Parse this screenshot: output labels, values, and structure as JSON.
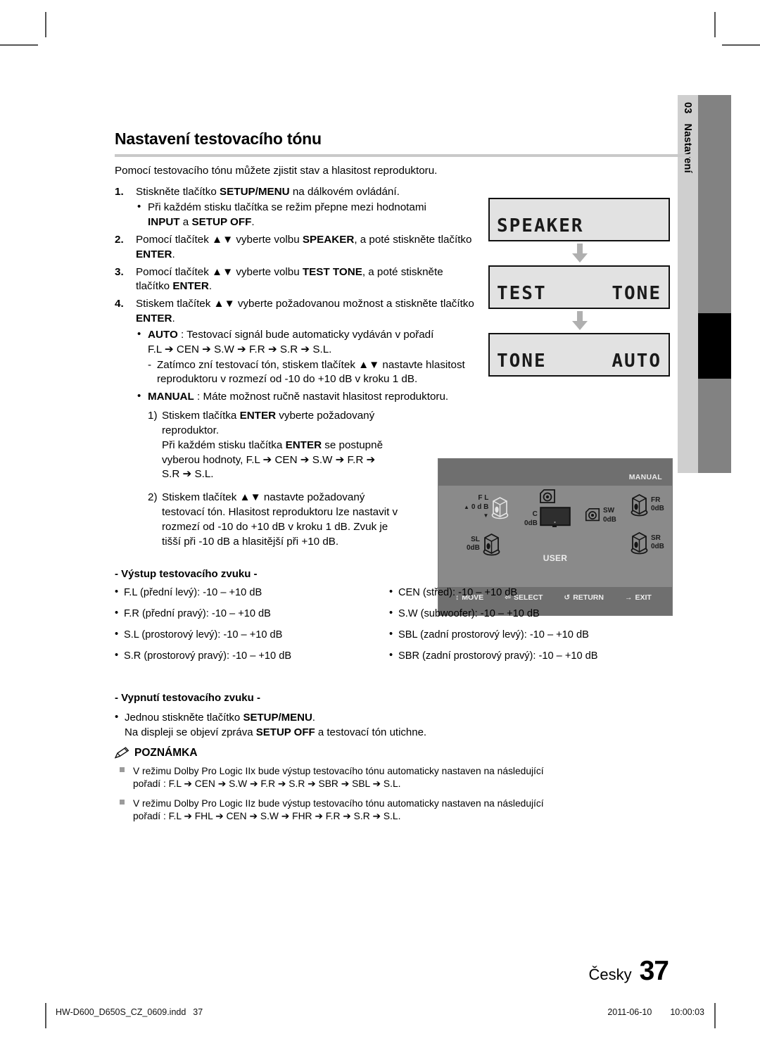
{
  "sidetab": {
    "number": "03",
    "label": "Nastavení"
  },
  "heading": "Nastavení testovacího tónu",
  "intro": "Pomocí testovacího tónu můžete zjistit stav a hlasitost reproduktoru.",
  "steps": [
    {
      "num": "1.",
      "text_a": "Stiskněte tlačítko ",
      "bold_a": "SETUP/MENU",
      "text_b": " na dálkovém ovládání.",
      "sub": {
        "dot": "•",
        "line1": "Při každém stisku tlačítka se režim přepne mezi hodnotami",
        "b1": "INPUT",
        "mid": " a ",
        "b2": "SETUP OFF",
        "tail": "."
      }
    },
    {
      "num": "2.",
      "text_a": "Pomocí tlačítek ▲▼ vyberte volbu ",
      "bold_a": "SPEAKER",
      "text_b": ", a poté stiskněte tlačítko ",
      "bold_b": "ENTER",
      "text_c": "."
    },
    {
      "num": "3.",
      "text_a": "Pomocí tlačítek ▲▼ vyberte volbu ",
      "bold_a": "TEST TONE",
      "text_b": ", a poté stiskněte tlačítko ",
      "bold_b": "ENTER",
      "text_c": "."
    },
    {
      "num": "4.",
      "text_a": "Stiskem tlačítek ▲▼ vyberte požadovanou možnost a stiskněte tlačítko ",
      "bold_a": "ENTER",
      "text_b": "."
    }
  ],
  "auto": {
    "dot": "•",
    "bold": "AUTO",
    "text": " : Testovací signál bude automaticky vydáván v pořadí",
    "order": "F.L ➔ CEN ➔ S.W ➔ F.R ➔ S.R ➔ S.L.",
    "dash": "-",
    "note": "Zatímco zní testovací tón, stiskem tlačítek ▲▼ nastavte hlasitost reproduktoru v rozmezí od -10 do +10 dB v kroku 1 dB."
  },
  "manual": {
    "dot": "•",
    "bold": "MANUAL",
    "text": " : Máte možnost ručně nastavit hlasitost reproduktoru.",
    "item1": {
      "n": "1)",
      "a": "Stiskem tlačítka ",
      "b1": "ENTER",
      "b": " vyberte požadovaný reproduktor.",
      "c": "Při každém stisku tlačítka ",
      "b2": "ENTER",
      "d": " se postupně vyberou hodnoty, F.L ➔ CEN ➔ S.W ➔ F.R ➔ S.R ➔ S.L."
    },
    "item2": {
      "n": "2)",
      "a": "Stiskem tlačítek ▲▼ nastavte požadovaný testovací tón. Hlasitost reproduktoru lze nastavit v rozmezí od -10 do +10 dB v kroku 1 dB. Zvuk je tišší při -10 dB a hlasitější při +10 dB."
    }
  },
  "lcd_panels": [
    {
      "left": "SPEAKER",
      "right": ""
    },
    {
      "left": "TEST",
      "right": "TONE"
    },
    {
      "left": "TONE",
      "right": "AUTO"
    }
  ],
  "osd": {
    "mode": "MANUAL",
    "center_label": "USER",
    "speakers": [
      {
        "id": "fl",
        "name": "F L",
        "db": "0 d B",
        "selected": true
      },
      {
        "id": "c",
        "name": "C",
        "db": "0dB",
        "selected": false
      },
      {
        "id": "sw",
        "name": "SW",
        "db": "0dB",
        "selected": false
      },
      {
        "id": "fr",
        "name": "FR",
        "db": "0dB",
        "selected": false
      },
      {
        "id": "sl",
        "name": "SL",
        "db": "0dB",
        "selected": false
      },
      {
        "id": "sr",
        "name": "SR",
        "db": "0dB",
        "selected": false
      }
    ],
    "footer": [
      {
        "icon": "updown-arrow-icon",
        "glyph": "↕",
        "label": "MOVE"
      },
      {
        "icon": "select-icon",
        "glyph": "⏎",
        "label": "SELECT"
      },
      {
        "icon": "return-icon",
        "glyph": "↺",
        "label": "RETURN"
      },
      {
        "icon": "exit-icon",
        "glyph": "→",
        "label": "EXIT"
      }
    ]
  },
  "output_section": {
    "heading": "- Výstup testovacího zvuku -",
    "left": [
      "F.L (přední levý): -10 – +10 dB",
      "F.R (přední pravý): -10 – +10 dB",
      "S.L (prostorový levý): -10 – +10 dB",
      "S.R (prostorový pravý): -10 – +10 dB"
    ],
    "right": [
      "CEN (střed): -10 – +10 dB",
      "S.W (subwoofer): -10 – +10 dB",
      "SBL (zadní prostorový levý): -10 – +10 dB",
      "SBR (zadní prostorový pravý): -10 – +10 dB"
    ]
  },
  "off_section": {
    "heading": "- Vypnutí testovacího zvuku -",
    "dot": "•",
    "line1_a": "Jednou stiskněte tlačítko ",
    "line1_b": "SETUP/MENU",
    "line1_c": ".",
    "line2_a": "Na displeji se objeví zpráva ",
    "line2_b": "SETUP OFF",
    "line2_c": " a testovací tón utichne."
  },
  "note": {
    "title": "POZNÁMKA",
    "items": [
      {
        "line1": "V režimu Dolby Pro Logic IIx bude výstup testovacího tónu automaticky nastaven na následující",
        "line2": "pořadí : F.L ➔ CEN ➔ S.W ➔ F.R ➔ S.R ➔ SBR ➔ SBL ➔ S.L."
      },
      {
        "line1": "V režimu Dolby Pro Logic IIz bude výstup testovacího tónu automaticky nastaven na následující",
        "line2": "pořadí : F.L ➔ FHL ➔ CEN ➔ S.W ➔ FHR ➔ F.R ➔ S.R ➔ S.L."
      }
    ]
  },
  "page_footer": {
    "language": "Česky",
    "page_number": "37",
    "file_name": "HW-D600_D650S_CZ_0609.indd",
    "file_page": "37",
    "date": "2011-06-10",
    "time": "10:00:03"
  }
}
